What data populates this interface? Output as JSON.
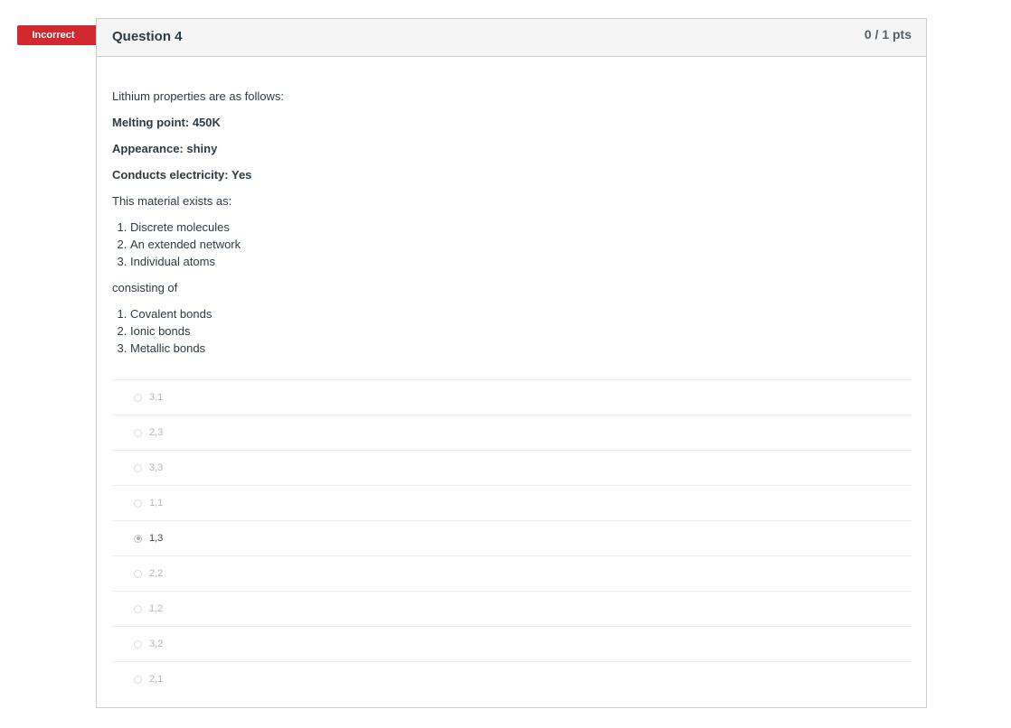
{
  "badge": {
    "label": "Incorrect",
    "color": "#d0292f"
  },
  "question": {
    "title": "Question 4",
    "points": "0 / 1 pts",
    "intro": "Lithium properties are as follows:",
    "properties": [
      {
        "label": "Melting point:",
        "value": "450K"
      },
      {
        "label": "Appearance:",
        "value": "shiny"
      },
      {
        "label": "Conducts electricity:",
        "value": "Yes"
      }
    ],
    "prompt1": "This material exists as:",
    "structures": [
      "Discrete molecules",
      "An extended network",
      "Individual atoms"
    ],
    "prompt2": "consisting of",
    "bonds": [
      "Covalent bonds",
      "Ionic bonds",
      "Metallic bonds"
    ]
  },
  "answers": [
    {
      "label": "3,1",
      "selected": false
    },
    {
      "label": "2,3",
      "selected": false
    },
    {
      "label": "3,3",
      "selected": false
    },
    {
      "label": "1,1",
      "selected": false
    },
    {
      "label": "1,3",
      "selected": true
    },
    {
      "label": "2,2",
      "selected": false
    },
    {
      "label": "1,2",
      "selected": false
    },
    {
      "label": "3,2",
      "selected": false
    },
    {
      "label": "2,1",
      "selected": false
    }
  ]
}
